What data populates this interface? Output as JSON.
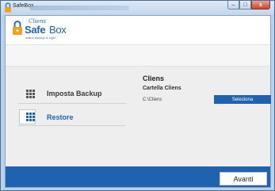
{
  "window": {
    "title": "SafeBox"
  },
  "window_controls": {
    "minimize": "–",
    "maximize": "□",
    "close": "x"
  },
  "logo": {
    "tagline": "Cliens",
    "name_part1": "Safe",
    "name_part2": "Box",
    "subtitle": "online backup & login"
  },
  "sidebar": {
    "items": [
      {
        "label": "Imposta Backup",
        "icon": "grid-icon",
        "selected": false
      },
      {
        "label": "Restore",
        "icon": "grid-icon",
        "selected": true
      }
    ]
  },
  "panel": {
    "title": "Cliens",
    "subtitle": "Cartella Cliens",
    "path": "C:\\Cliens",
    "select_button": "Seleziona"
  },
  "footer": {
    "next_button": "Avanti"
  },
  "colors": {
    "accent": "#1f62b0",
    "content_bg": "#eeeeee",
    "window_frame": "#b9d1ea"
  }
}
